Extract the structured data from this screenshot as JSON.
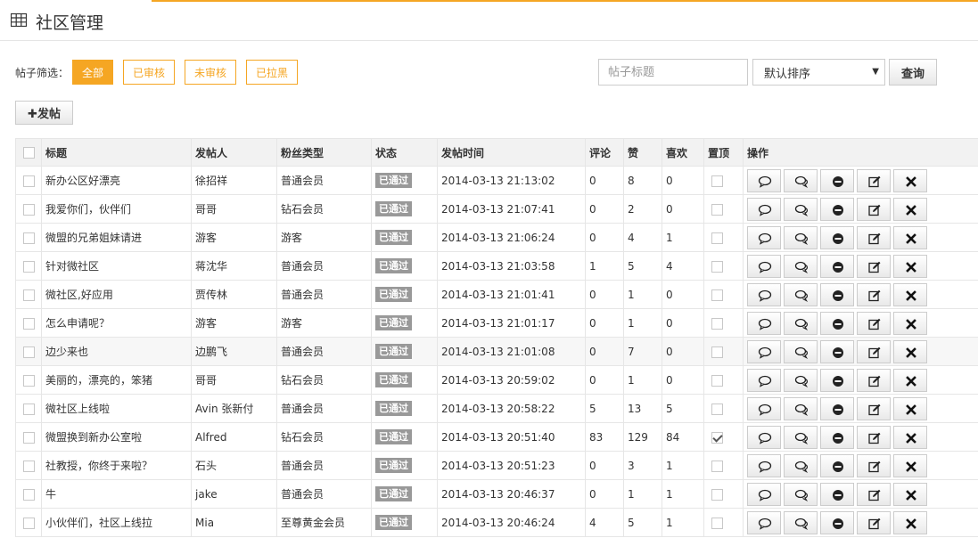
{
  "header": {
    "title": "社区管理",
    "icon": "table-grid-icon"
  },
  "filter": {
    "label": "帖子筛选：",
    "buttons": [
      {
        "label": "全部",
        "active": true
      },
      {
        "label": "已审核",
        "active": false
      },
      {
        "label": "未审核",
        "active": false
      },
      {
        "label": "已拉黑",
        "active": false
      }
    ]
  },
  "search": {
    "placeholder": "帖子标题",
    "value": ""
  },
  "sort": {
    "selected": "默认排序"
  },
  "query_label": "查询",
  "post_button_label": "✚发帖",
  "colors": {
    "accent": "#f5a623",
    "status_bg": "#999999"
  },
  "table": {
    "headers": [
      "标题",
      "发帖人",
      "粉丝类型",
      "状态",
      "发帖时间",
      "评论",
      "赞",
      "喜欢",
      "置顶",
      "操作"
    ],
    "rows": [
      {
        "title": "新办公区好漂亮",
        "author": "徐招祥",
        "fan_type": "普通会员",
        "status": "已通过",
        "time": "2014-03-13 21:13:02",
        "comments": "0",
        "likes": "8",
        "favorites": "0",
        "pinned": false
      },
      {
        "title": "我爱你们，伙伴们",
        "author": "哥哥",
        "fan_type": "钻石会员",
        "status": "已通过",
        "time": "2014-03-13 21:07:41",
        "comments": "0",
        "likes": "2",
        "favorites": "0",
        "pinned": false
      },
      {
        "title": "微盟的兄弟姐妹请进",
        "author": "游客",
        "fan_type": "游客",
        "status": "已通过",
        "time": "2014-03-13 21:06:24",
        "comments": "0",
        "likes": "4",
        "favorites": "1",
        "pinned": false
      },
      {
        "title": "针对微社区",
        "author": "蒋沈华",
        "fan_type": "普通会员",
        "status": "已通过",
        "time": "2014-03-13 21:03:58",
        "comments": "1",
        "likes": "5",
        "favorites": "4",
        "pinned": false
      },
      {
        "title": "微社区,好应用",
        "author": "贾传林",
        "fan_type": "普通会员",
        "status": "已通过",
        "time": "2014-03-13 21:01:41",
        "comments": "0",
        "likes": "1",
        "favorites": "0",
        "pinned": false
      },
      {
        "title": "怎么申请呢？",
        "author": "游客",
        "fan_type": "游客",
        "status": "已通过",
        "time": "2014-03-13 21:01:17",
        "comments": "0",
        "likes": "1",
        "favorites": "0",
        "pinned": false
      },
      {
        "title": "边少来也",
        "author": "边鹏飞",
        "fan_type": "普通会员",
        "status": "已通过",
        "time": "2014-03-13 21:01:08",
        "comments": "0",
        "likes": "7",
        "favorites": "0",
        "pinned": false
      },
      {
        "title": "美丽的，漂亮的，笨猪",
        "author": "哥哥",
        "fan_type": "钻石会员",
        "status": "已通过",
        "time": "2014-03-13 20:59:02",
        "comments": "0",
        "likes": "1",
        "favorites": "0",
        "pinned": false
      },
      {
        "title": "微社区上线啦",
        "author": "Avin 张新付",
        "fan_type": "普通会员",
        "status": "已通过",
        "time": "2014-03-13 20:58:22",
        "comments": "5",
        "likes": "13",
        "favorites": "5",
        "pinned": false
      },
      {
        "title": "微盟换到新办公室啦",
        "author": "Alfred",
        "fan_type": "钻石会员",
        "status": "已通过",
        "time": "2014-03-13 20:51:40",
        "comments": "83",
        "likes": "129",
        "favorites": "84",
        "pinned": true
      },
      {
        "title": "社教授，你终于来啦？",
        "author": "石头",
        "fan_type": "普通会员",
        "status": "已通过",
        "time": "2014-03-13 20:51:23",
        "comments": "0",
        "likes": "3",
        "favorites": "1",
        "pinned": false
      },
      {
        "title": "牛",
        "author": "jake",
        "fan_type": "普通会员",
        "status": "已通过",
        "time": "2014-03-13 20:46:37",
        "comments": "0",
        "likes": "1",
        "favorites": "1",
        "pinned": false
      },
      {
        "title": "小伙伴们，社区上线拉",
        "author": "Mia",
        "fan_type": "至尊黄金会员",
        "status": "已通过",
        "time": "2014-03-13 20:46:24",
        "comments": "4",
        "likes": "5",
        "favorites": "1",
        "pinned": false
      }
    ],
    "action_icons": [
      "comment-icon",
      "replies-icon",
      "block-icon",
      "edit-icon",
      "delete-icon"
    ]
  }
}
